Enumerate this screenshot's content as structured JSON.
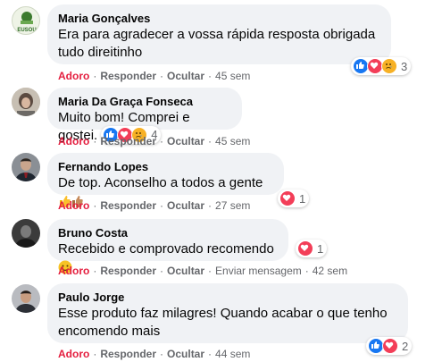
{
  "colors": {
    "bubble_bg": "#f0f2f5",
    "meta_gray": "#65676b",
    "liked_red": "#e41e3f",
    "like_blue": "#1877f2",
    "love_red": "#f33e58",
    "sad_yellow": "#f7b125"
  },
  "labels": {
    "like": "Adoro",
    "reply": "Responder",
    "hide": "Ocultar",
    "send_message": "Enviar mensagem"
  },
  "comments": [
    {
      "name": "Maria Gonçalves",
      "avatar_text": "EUSOU",
      "text": "Era para agradecer a vossa rápida resposta obrigada tudo direitinho",
      "time": "45 sem",
      "reactions": [
        "like-icon",
        "love-icon",
        "sad-icon"
      ],
      "reaction_count": "3"
    },
    {
      "name": "Maria Da Graça Fonseca",
      "text": "Muito bom! Comprei e gostei.",
      "time": "45 sem",
      "reactions": [
        "like-icon",
        "love-icon",
        "sad-icon"
      ],
      "reaction_count": "4"
    },
    {
      "name": "Fernando Lopes",
      "text": "De top. Aconselho a todos a gente",
      "emojis": [
        "thumbs-up-icon",
        "thumbs-up-icon"
      ],
      "time": "27 sem",
      "reactions": [
        "love-icon"
      ],
      "reaction_count": "1"
    },
    {
      "name": "Bruno Costa",
      "text": "Recebido e comprovado recomendo",
      "emojis": [
        "smile-icon"
      ],
      "time": "42 sem",
      "reactions": [
        "love-icon"
      ],
      "reaction_count": "1"
    },
    {
      "name": "Paulo Jorge",
      "text": "Esse produto faz milagres! Quando acabar o que tenho encomendo mais",
      "time": "44 sem",
      "reactions": [
        "like-icon",
        "love-icon"
      ],
      "reaction_count": "2"
    }
  ]
}
